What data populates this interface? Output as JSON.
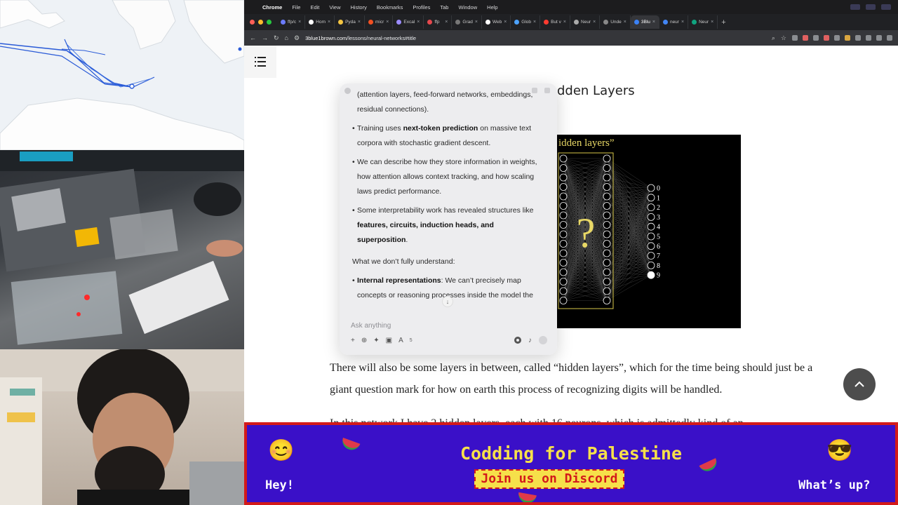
{
  "menubar": {
    "items": [
      "Chrome",
      "File",
      "Edit",
      "View",
      "History",
      "Bookmarks",
      "Profiles",
      "Tab",
      "Window",
      "Help"
    ]
  },
  "tabs": [
    {
      "label": "ffp/c"
    },
    {
      "label": "Hom"
    },
    {
      "label": "Pyda"
    },
    {
      "label": "micr"
    },
    {
      "label": "Excal"
    },
    {
      "label": "ffp"
    },
    {
      "label": "Grad"
    },
    {
      "label": "Web"
    },
    {
      "label": "Glob"
    },
    {
      "label": "But v"
    },
    {
      "label": "Neur"
    },
    {
      "label": "Unde"
    },
    {
      "label": "3Blu",
      "active": true
    },
    {
      "label": "neur"
    },
    {
      "label": "Neur"
    }
  ],
  "address": {
    "host": "3blue1brown.com",
    "path": "/lessons/neural-networks#title"
  },
  "page": {
    "heading": "dden Layers",
    "figure_title": "idden layers”",
    "figure_question": "?",
    "figure_outputs": [
      "0",
      "1",
      "2",
      "3",
      "4",
      "5",
      "6",
      "7",
      "8",
      "9"
    ],
    "paragraph": "There will also be some layers in between, called “hidden layers”, which for the time being should just be a giant question mark for how on earth this process of recognizing digits will be handled.",
    "paragraph_next": "In this network I have 2 hidden layers, each with 16 neurons, which is admittedly kind of an"
  },
  "chat": {
    "bullets_top": [
      {
        "pre": "(attention layers, feed-forward networks, embeddings, residual connections).",
        "bold": "",
        "post": ""
      }
    ],
    "bullets": [
      {
        "pre": "Training uses ",
        "bold": "next-token prediction",
        "post": " on massive text corpora with stochastic gradient descent."
      },
      {
        "pre": "We can describe how they store information in weights, how attention allows context tracking, and how scaling laws predict performance.",
        "bold": "",
        "post": ""
      },
      {
        "pre": "Some interpretability work has revealed structures like ",
        "bold": "features, circuits, induction heads, and superposition",
        "post": "."
      }
    ],
    "lead": "What we don’t fully understand:",
    "bullets2": [
      {
        "pre": "",
        "bold": "Internal representations",
        "post": ": We can’t precisely map concepts or reasoning processes inside the model the"
      }
    ],
    "input_placeholder": "Ask anything",
    "attach_count": "5"
  },
  "banner": {
    "title": "Codding for Palestine",
    "cta": "Join us on Discord",
    "left": "Hey!",
    "right": "What’s up?",
    "colors": {
      "bg": "#3a10c8",
      "border": "#d31a1a",
      "accent": "#f6e04a"
    }
  }
}
